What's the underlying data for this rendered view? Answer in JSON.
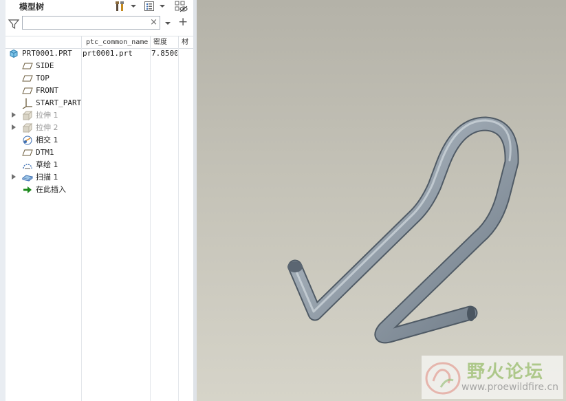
{
  "panel": {
    "title": "模型树",
    "search": {
      "value": "",
      "placeholder": "",
      "clear": "×"
    },
    "add": "+",
    "columns": [
      "ptc_common_name",
      "密度",
      "材"
    ]
  },
  "tree": [
    {
      "label": "PRT0001.PRT",
      "icon": "part-icon",
      "common_name": "prt0001.prt",
      "density": "7.8500",
      "expandable": false,
      "dim": false
    },
    {
      "label": "SIDE",
      "icon": "datum-plane-icon",
      "expandable": false,
      "dim": false
    },
    {
      "label": "TOP",
      "icon": "datum-plane-icon",
      "expandable": false,
      "dim": false
    },
    {
      "label": "FRONT",
      "icon": "datum-plane-icon",
      "expandable": false,
      "dim": false
    },
    {
      "label": "START_PART",
      "icon": "coordinate-system-icon",
      "expandable": false,
      "dim": false
    },
    {
      "label": "拉伸 1",
      "icon": "extrude-icon",
      "expandable": true,
      "dim": true
    },
    {
      "label": "拉伸 2",
      "icon": "extrude-icon",
      "expandable": true,
      "dim": true
    },
    {
      "label": "相交 1",
      "icon": "intersect-icon",
      "expandable": false,
      "dim": false
    },
    {
      "label": "DTM1",
      "icon": "datum-plane-icon",
      "expandable": false,
      "dim": false
    },
    {
      "label": "草绘 1",
      "icon": "sketch-icon",
      "expandable": false,
      "dim": false
    },
    {
      "label": "扫描 1",
      "icon": "sweep-icon",
      "expandable": true,
      "dim": false
    },
    {
      "label": "在此插入",
      "icon": "insert-here-icon",
      "expandable": false,
      "dim": false
    }
  ],
  "watermark": {
    "title": "野火论坛",
    "url": "www.proewildfire.cn"
  },
  "colors": {
    "viewport_top": "#b4b2a8",
    "viewport_bottom": "#d6d4c9",
    "pipe": "#8a96a3",
    "insert_arrow": "#1d8a1d"
  }
}
